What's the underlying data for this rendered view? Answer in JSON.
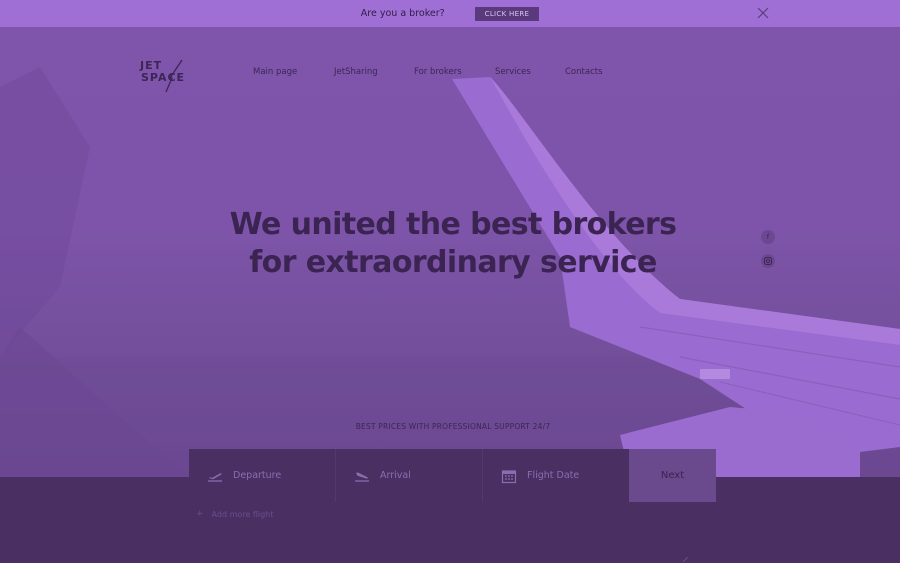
{
  "banner": {
    "question": "Are you a broker?",
    "cta_label": "CLICK HERE",
    "close_icon": "close-icon"
  },
  "logo": {
    "line1": "JET",
    "line2": "SPACE"
  },
  "nav": {
    "items": [
      "Main page",
      "JetSharing",
      "For brokers",
      "Services",
      "Contacts"
    ]
  },
  "hero": {
    "headline_line1": "We united the best brokers",
    "headline_line2": "for extraordinary service",
    "tagline": "BEST PRICES WITH PROFESSIONAL SUPPORT 24/7"
  },
  "social": {
    "facebook_glyph": "f",
    "instagram_icon": "instagram-icon"
  },
  "search": {
    "departure_label": "Departure",
    "arrival_label": "Arrival",
    "date_label": "Flight Date",
    "next_label": "Next",
    "add_flight": "Add more flight",
    "add_glyph": "+"
  },
  "colors": {
    "banner": "#a06fd6",
    "hero_tint": "#7f55ab",
    "form_bg": "#4a2f63",
    "page_bg": "#4a3062"
  }
}
